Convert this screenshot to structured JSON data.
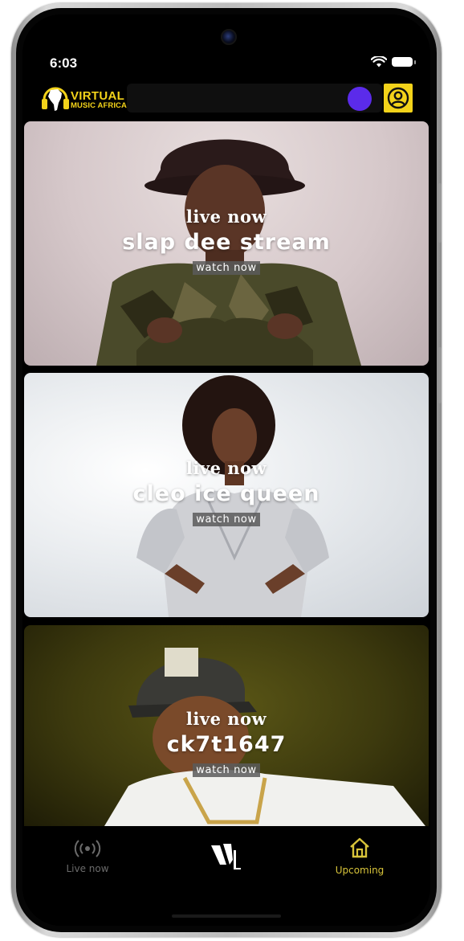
{
  "status_bar": {
    "time": "6:03",
    "icons": [
      "wifi-icon",
      "battery-icon"
    ]
  },
  "header": {
    "logo_line1": "VIRTUAL",
    "logo_line2": "MUSIC AFRICA",
    "accent_color": "#f3d31a",
    "dot_color": "#5b2bea",
    "profile_icon": "user-circle-icon"
  },
  "streams": [
    {
      "status": "live now",
      "title": "slap dee stream",
      "action": "watch now"
    },
    {
      "status": "live now",
      "title": "cleo ice queen",
      "action": "watch now"
    },
    {
      "status": "live now",
      "title": "ck7t1647",
      "action": "watch now"
    }
  ],
  "bottom_nav": {
    "items": [
      {
        "label": "Live now",
        "icon": "broadcast-icon",
        "active": false
      },
      {
        "label": "",
        "icon": "app-logo-icon",
        "active": false
      },
      {
        "label": "Upcoming",
        "icon": "home-icon",
        "active": true
      }
    ],
    "active_color": "#d8c43a",
    "inactive_color": "#6b6b6b"
  }
}
